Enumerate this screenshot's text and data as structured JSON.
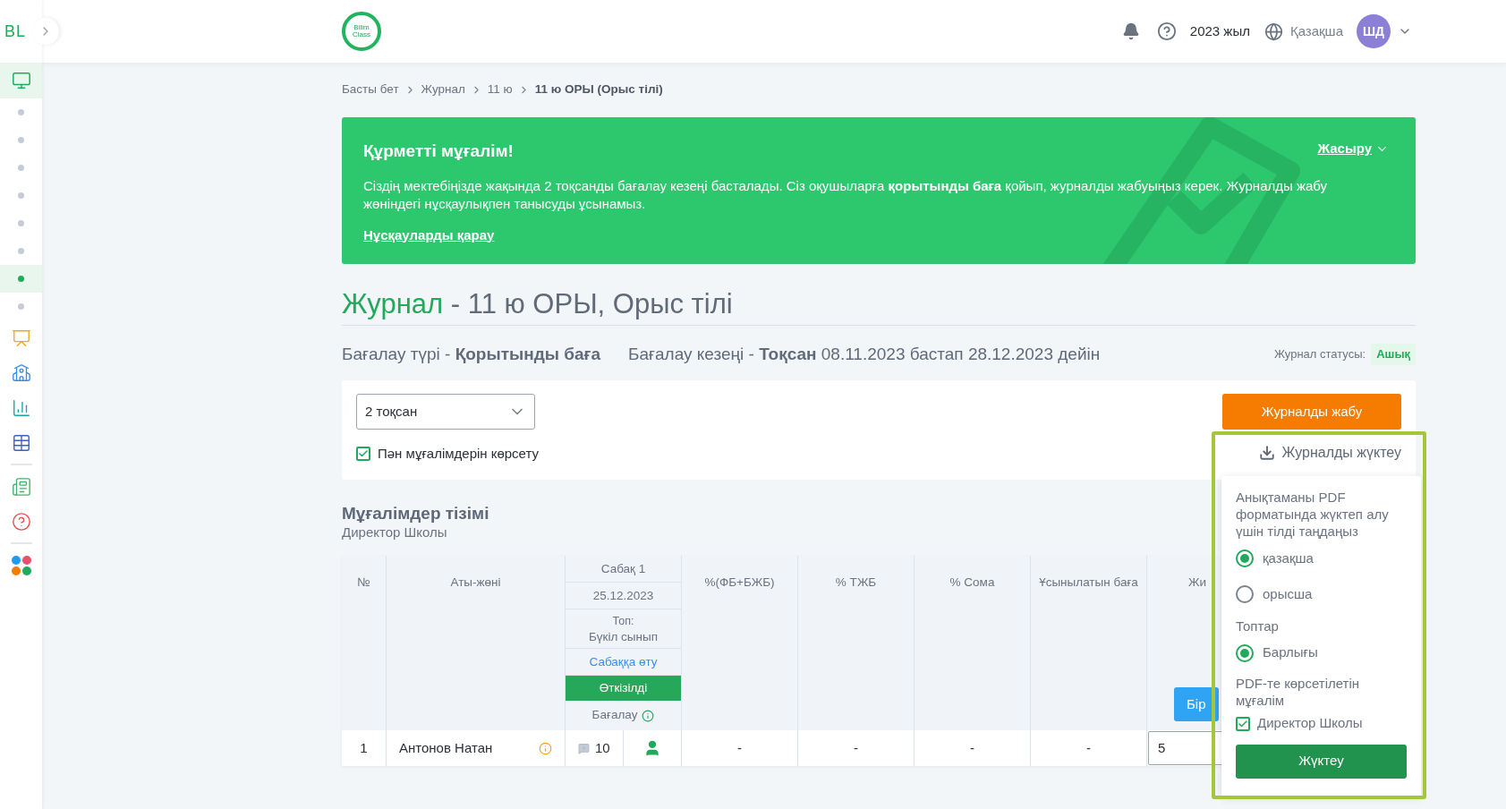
{
  "header": {
    "brand": "BL",
    "logo_lines": [
      "Bilim",
      "Class"
    ],
    "year": "2023 жыл",
    "language": "Қазақша",
    "avatar": "ШД"
  },
  "sidebar": {
    "top_item": {
      "selected": true
    },
    "dots": [
      {
        "selected": false
      },
      {
        "selected": false
      },
      {
        "selected": false
      },
      {
        "selected": false
      },
      {
        "selected": false
      },
      {
        "selected": false
      },
      {
        "selected": true
      },
      {
        "selected": false
      }
    ],
    "icons": [
      {
        "selected": false
      },
      {
        "selected": false
      },
      {
        "selected": false
      },
      {
        "selected": false
      },
      {
        "selected": false
      },
      {
        "selected": false
      },
      {
        "selected": false
      }
    ]
  },
  "breadcrumbs": [
    {
      "label": "Басты бет",
      "current": false
    },
    {
      "label": "Журнал",
      "current": false
    },
    {
      "label": "11 ю",
      "current": false
    },
    {
      "label": "11 ю ОРЫ (Орыс тілі)",
      "current": true
    }
  ],
  "banner": {
    "title": "Құрметті мұғалім!",
    "hide_link": "Жасыру",
    "text": "Сіздің мектебіңізде жақында 2 тоқсанды бағалау кезеңі басталады. Сіз оқушыларға **қорытынды баға** қойып, журналды жабуыңыз керек. Журналды жабу жөніндегі нұсқаулықпен танысуды ұсынамыз.",
    "link": "Нұсқауларды қарау"
  },
  "journal": {
    "title_accent": "Журнал",
    "title_rest": "- 11 ю ОРЫ, Орыс тілі",
    "assessment_type": "Бағалау түрі - **Қорытынды баға**",
    "assessment_period": "Бағалау кезеңі - **Тоқсан** 08.11.2023 бастап 28.12.2023 дейін",
    "status_label": "Журнал статусы:",
    "status": "Ашық"
  },
  "controls": {
    "period_select": "2 тоқсан",
    "show_teachers": {
      "label": "Пән мұғалімдерін көрсету",
      "checked": true
    },
    "close_button": "Журналды жабу",
    "download_button": "Журналды жүктеу"
  },
  "teachers": {
    "title": "Мұғалімдер тізімі",
    "subtitle": "Директор Школы"
  },
  "table": {
    "columns_left": [
      "№",
      "Аты-жөні"
    ],
    "lesson": {
      "title": "Сабақ 1",
      "date": "25.12.2023",
      "group_label": "Топ:",
      "group": "Бүкіл сынып",
      "link": "Сабаққа өту",
      "status": "Өткізілді",
      "grading": "Бағалау"
    },
    "columns_right": [
      "%(ФБ+БЖБ)",
      "% ТЖБ",
      "% Сома",
      "Ұсынылатын баға"
    ],
    "column_last": "Жи",
    "apply_button": "Бір",
    "rows": [
      {
        "number": "1",
        "name": "Антонов Натан",
        "comments": "10",
        "cells": [
          "-",
          "-",
          "-",
          "-"
        ],
        "grade": "5"
      }
    ]
  },
  "download_popup": {
    "prompt": "Анықтаманы PDF форматында жүктеп алу үшін тілді таңдаңыз",
    "languages": [
      {
        "label": "қазақша",
        "selected": true
      },
      {
        "label": "орысша",
        "selected": false
      }
    ],
    "groups_label": "Топтар",
    "groups": [
      {
        "label": "Барлығы",
        "selected": true
      }
    ],
    "teacher_label": "PDF-те көрсетілетін мұғалім",
    "teachers": [
      {
        "label": "Директор Школы",
        "checked": true
      }
    ],
    "button": "Жүктеу"
  }
}
